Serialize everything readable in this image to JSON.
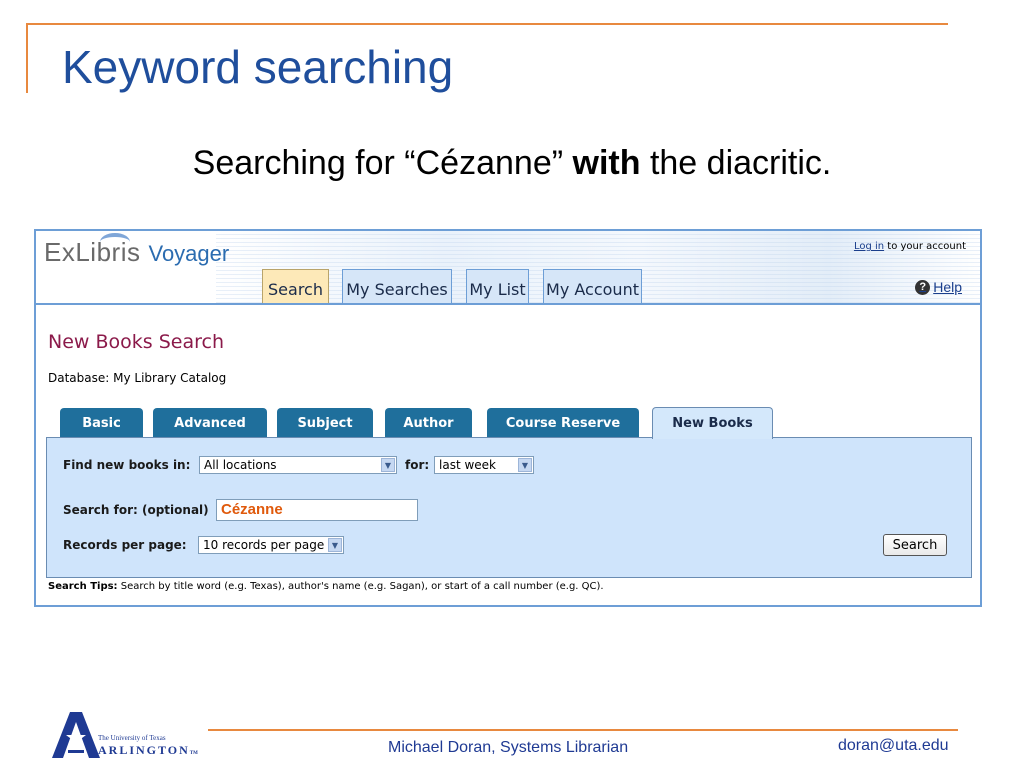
{
  "slide": {
    "title": "Keyword searching",
    "subtitle_pre": "Searching for “Cézanne” ",
    "subtitle_bold": "with",
    "subtitle_post": " the diacritic."
  },
  "header": {
    "logo_exlibris": "ExLibris",
    "logo_product": "Voyager",
    "login_link": "Log in",
    "login_rest": " to your account",
    "help_label": "Help",
    "tabs": [
      {
        "label": "Search",
        "active": true
      },
      {
        "label": "My Searches",
        "active": false
      },
      {
        "label": "My List",
        "active": false
      },
      {
        "label": "My Account",
        "active": false
      }
    ]
  },
  "page": {
    "heading": "New Books Search",
    "database_line": "Database: My Library Catalog"
  },
  "search_tabs": [
    {
      "label": "Basic",
      "active": false
    },
    {
      "label": "Advanced",
      "active": false
    },
    {
      "label": "Subject",
      "active": false
    },
    {
      "label": "Author",
      "active": false
    },
    {
      "label": "Course Reserve",
      "active": false
    },
    {
      "label": "New Books",
      "active": true
    }
  ],
  "form": {
    "find_label": "Find new books in:",
    "location_value": "All locations",
    "for_label": "for:",
    "period_value": "last week",
    "search_for_label": "Search for: (optional)",
    "search_value": "Cézanne",
    "records_label": "Records per page:",
    "records_value": "10 records per page",
    "search_button": "Search"
  },
  "tips": {
    "label": "Search Tips:",
    "text": " Search by title word (e.g. Texas), author's name (e.g. Sagan), or start of a call number (e.g. QC)."
  },
  "footer": {
    "uta_small": "The University of Texas",
    "uta_big": "ARLINGTON",
    "uta_tm": "TM",
    "presenter": "Michael Doran, Systems Librarian",
    "email": "doran@uta.edu"
  },
  "colors": {
    "accent_orange": "#e8893f",
    "title_blue": "#1f4e9c",
    "heading_maroon": "#8b1a4a",
    "tab_dark": "#1f6f9c",
    "form_bg": "#cfe4fb",
    "query_orange": "#e05a0c"
  }
}
